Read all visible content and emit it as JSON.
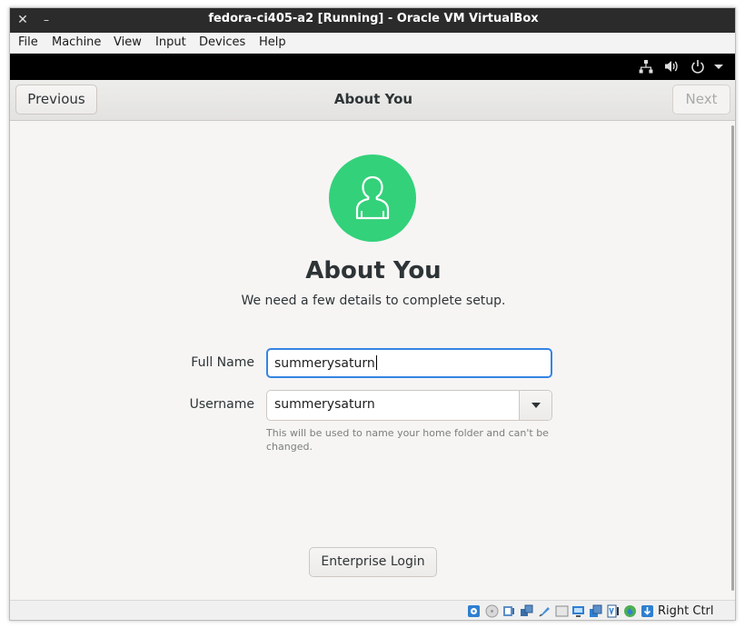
{
  "window": {
    "title": "fedora-ci405-a2 [Running] - Oracle VM VirtualBox",
    "close_glyph": "✕",
    "minimize_glyph": "–"
  },
  "menubar": {
    "items": [
      "File",
      "Machine",
      "View",
      "Input",
      "Devices",
      "Help"
    ]
  },
  "guest_topbar": {
    "icons": [
      "network-icon",
      "volume-icon",
      "power-icon",
      "dropdown-arrow-icon"
    ]
  },
  "header": {
    "previous_label": "Previous",
    "title": "About You",
    "next_label": "Next"
  },
  "form": {
    "heading": "About You",
    "subheading": "We need a few details to complete setup.",
    "full_name_label": "Full Name",
    "full_name_value": "summerysaturn",
    "username_label": "Username",
    "username_value": "summerysaturn",
    "username_hint": "This will be used to name your home folder and can't be changed.",
    "enterprise_login_label": "Enterprise Login"
  },
  "statusbar": {
    "host_key": "Right Ctrl",
    "icons": [
      "hard-disk-icon",
      "optical-drive-icon",
      "audio-icon",
      "network-adapter-icon",
      "usb-icon",
      "shared-folders-icon",
      "display-icon",
      "video-capture-icon",
      "cpu-icon",
      "mouse-integration-icon",
      "keyboard-capture-icon"
    ]
  },
  "colors": {
    "accent": "#3584e4",
    "avatar_bg": "#33d17a",
    "titlebar_bg": "#2b2b2b",
    "guest_topbar_bg": "#000000"
  }
}
